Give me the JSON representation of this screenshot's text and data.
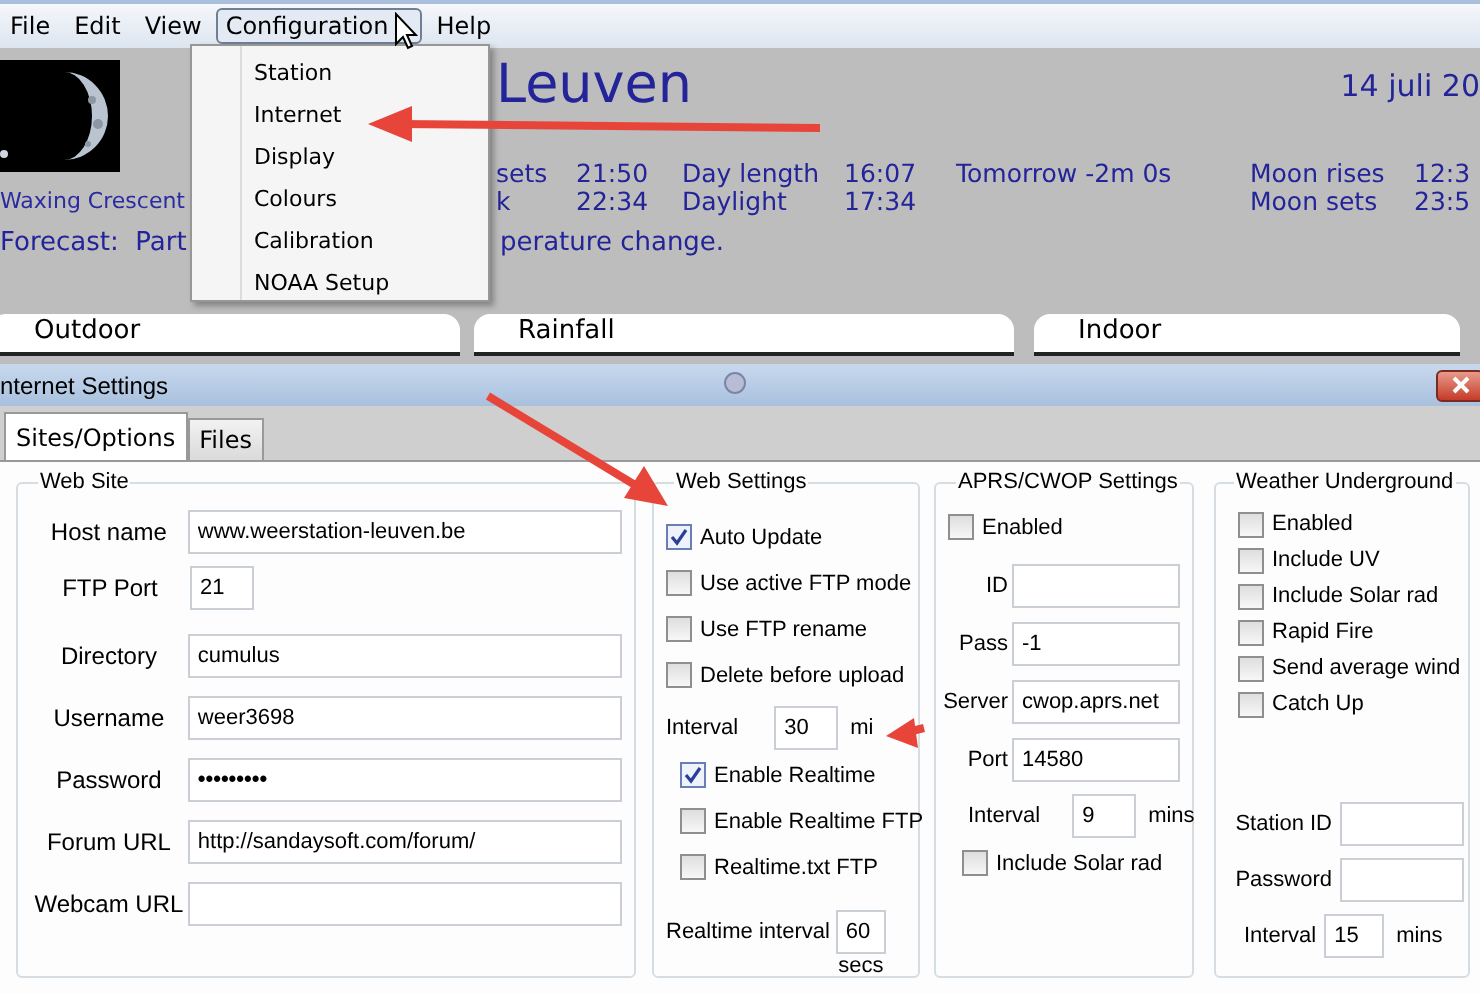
{
  "menu_bar": {
    "items": [
      {
        "label": "File",
        "open": false
      },
      {
        "label": "Edit",
        "open": false
      },
      {
        "label": "View",
        "open": false
      },
      {
        "label": "Configuration",
        "open": true
      },
      {
        "label": "Help",
        "open": false
      }
    ]
  },
  "config_menu": {
    "items": [
      "Station",
      "Internet",
      "Display",
      "Colours",
      "Calibration",
      "NOAA Setup"
    ]
  },
  "station": {
    "title": "Leuven",
    "date": "14 juli 20",
    "moon_phase": "Waxing Crescent",
    "info_rows": [
      {
        "label": "sets",
        "time": "21:50",
        "length_label": "Day length",
        "length": "16:07",
        "change": "Tomorrow -2m 0s",
        "moon_label": "Moon rises",
        "moon_time": "12:3"
      },
      {
        "label": "k",
        "time": "22:34",
        "length_label": "Daylight",
        "length": "17:34",
        "moon_label": "Moon sets",
        "moon_time": "23:5"
      }
    ],
    "forecast": {
      "left": "Forecast:  Part",
      "right": "perature change."
    }
  },
  "panel_tabs": [
    "Outdoor",
    "Rainfall",
    "Indoor"
  ],
  "dialog": {
    "title": "nternet Settings",
    "tabs": [
      {
        "label": "Sites/Options",
        "selected": true
      },
      {
        "label": "Files",
        "selected": false
      }
    ],
    "web_site": {
      "title": "Web Site",
      "fields": [
        {
          "label": "Host name",
          "value": "www.weerstation-leuven.be",
          "kind": "wide"
        },
        {
          "label": "FTP Port",
          "value": "21",
          "kind": "short"
        },
        {
          "label": "Directory",
          "value": "cumulus",
          "kind": "wide"
        },
        {
          "label": "Username",
          "value": "weer3698",
          "kind": "wide"
        },
        {
          "label": "Password",
          "value": "•••••••••",
          "kind": "wide"
        },
        {
          "label": "Forum URL",
          "value": "http://sandaysoft.com/forum/",
          "kind": "wide"
        },
        {
          "label": "Webcam URL",
          "kind": "wide"
        }
      ]
    },
    "web_settings": {
      "title": "Web Settings",
      "options": [
        {
          "label": "Auto Update",
          "checked": true
        },
        {
          "label": "Use active FTP mode",
          "checked": false
        },
        {
          "label": "Use FTP rename",
          "checked": false
        },
        {
          "label": "Delete before upload",
          "checked": false
        }
      ],
      "interval": {
        "label": "Interval",
        "value": "30",
        "unit": "mi"
      },
      "realtime_options": [
        {
          "label": "Enable Realtime",
          "checked": true
        },
        {
          "label": "Enable Realtime FTP",
          "checked": false
        },
        {
          "label": "Realtime.txt FTP",
          "checked": false
        }
      ],
      "realtime_interval": {
        "label": "Realtime interval",
        "value": "60",
        "unit": "secs"
      }
    },
    "aprs": {
      "title": "APRS/CWOP Settings",
      "enabled": {
        "label": "Enabled",
        "checked": false
      },
      "fields": [
        {
          "label": "ID"
        },
        {
          "label": "Pass",
          "value": "-1"
        },
        {
          "label": "Server",
          "value": "cwop.aprs.net"
        },
        {
          "label": "Port",
          "value": "14580"
        }
      ],
      "interval": {
        "label": "Interval",
        "value": "9",
        "unit": "mins"
      },
      "include_solar": {
        "label": "Include Solar rad",
        "checked": false
      }
    },
    "wunderground": {
      "title": "Weather Underground",
      "options": [
        {
          "label": "Enabled",
          "checked": false
        },
        {
          "label": "Include UV",
          "checked": false
        },
        {
          "label": "Include Solar rad",
          "checked": false
        },
        {
          "label": "Rapid Fire",
          "checked": false
        },
        {
          "label": "Send average wind",
          "checked": false
        },
        {
          "label": "Catch Up",
          "checked": false
        }
      ],
      "fields": [
        {
          "label": "Station ID"
        },
        {
          "label": "Password"
        }
      ],
      "interval": {
        "label": "Interval",
        "value": "15",
        "unit": "mins"
      }
    }
  }
}
